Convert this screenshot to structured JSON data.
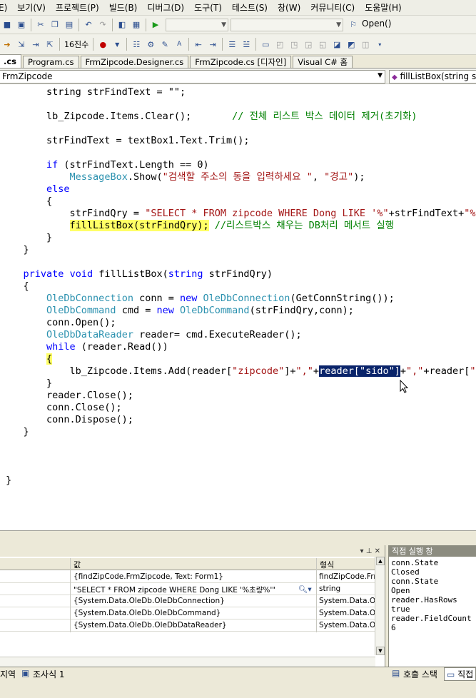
{
  "menu": [
    "E)",
    "보기(V)",
    "프로젝트(P)",
    "빌드(B)",
    "디버그(D)",
    "도구(T)",
    "테스트(S)",
    "창(W)",
    "커뮤니티(C)",
    "도움말(H)"
  ],
  "toolbar": {
    "hex_label": "16진수",
    "find_combo_value": "Open()"
  },
  "tabs": [
    {
      "label": ".cs",
      "active": true
    },
    {
      "label": "Program.cs",
      "active": false
    },
    {
      "label": "FrmZipcode.Designer.cs",
      "active": false
    },
    {
      "label": "FrmZipcode.cs [디자인]",
      "active": false
    },
    {
      "label": "Visual C# 홈",
      "active": false
    }
  ],
  "nav": {
    "type_combo": "FrmZipcode",
    "member_combo": "fillListBox(string s"
  },
  "code_lines": [
    [
      [
        "        string strFindText = \"\";",
        "n"
      ]
    ],
    [
      [
        "",
        "n"
      ]
    ],
    [
      [
        "        lb_Zipcode.Items.Clear();       ",
        "n"
      ],
      [
        "// 전체 리스트 박스 데이터 제거(초기화)",
        "cm"
      ]
    ],
    [
      [
        "",
        "n"
      ]
    ],
    [
      [
        "        strFindText = textBox1.Text.Trim();",
        "n"
      ]
    ],
    [
      [
        "",
        "n"
      ]
    ],
    [
      [
        "        ",
        "n"
      ],
      [
        "if",
        "kw"
      ],
      [
        " (strFindText.Length == 0)",
        "n"
      ]
    ],
    [
      [
        "            ",
        "n"
      ],
      [
        "MessageBox",
        "ty"
      ],
      [
        ".Show(",
        "n"
      ],
      [
        "\"검색할 주소의 동을 입력하세요 \"",
        "str"
      ],
      [
        ", ",
        "n"
      ],
      [
        "\"경고\"",
        "str"
      ],
      [
        ");",
        "n"
      ]
    ],
    [
      [
        "        ",
        "n"
      ],
      [
        "else",
        "kw"
      ]
    ],
    [
      [
        "        {",
        "n"
      ]
    ],
    [
      [
        "            strFindQry = ",
        "n"
      ],
      [
        "\"SELECT * FROM zipcode WHERE Dong LIKE '%\"",
        "str"
      ],
      [
        "+strFindText+",
        "n"
      ],
      [
        "\"%",
        "str"
      ]
    ],
    [
      [
        "            ",
        "n"
      ],
      [
        "fillListBox(strFindQry);",
        "yellow"
      ],
      [
        " ",
        "n"
      ],
      [
        "//리스트박스 채우는 DB처리 메서트 실행",
        "cm"
      ]
    ],
    [
      [
        "        }",
        "n"
      ]
    ],
    [
      [
        "    }",
        "n"
      ]
    ],
    [
      [
        "",
        "n"
      ]
    ],
    [
      [
        "    ",
        "n"
      ],
      [
        "private",
        "kw"
      ],
      [
        " ",
        "n"
      ],
      [
        "void",
        "kw"
      ],
      [
        " fillListBox(",
        "n"
      ],
      [
        "string",
        "kw"
      ],
      [
        " strFindQry)",
        "n"
      ]
    ],
    [
      [
        "    {",
        "n"
      ]
    ],
    [
      [
        "        ",
        "n"
      ],
      [
        "OleDbConnection",
        "ty"
      ],
      [
        " conn = ",
        "n"
      ],
      [
        "new",
        "kw"
      ],
      [
        " ",
        "n"
      ],
      [
        "OleDbConnection",
        "ty"
      ],
      [
        "(GetConnString());",
        "n"
      ]
    ],
    [
      [
        "        ",
        "n"
      ],
      [
        "OleDbCommand",
        "ty"
      ],
      [
        " cmd = ",
        "n"
      ],
      [
        "new",
        "kw"
      ],
      [
        " ",
        "n"
      ],
      [
        "OleDbCommand",
        "ty"
      ],
      [
        "(strFindQry,conn);",
        "n"
      ]
    ],
    [
      [
        "        conn.Open();",
        "n"
      ]
    ],
    [
      [
        "        ",
        "n"
      ],
      [
        "OleDbDataReader",
        "ty"
      ],
      [
        " reader= cmd.ExecuteReader();",
        "n"
      ]
    ],
    [
      [
        "        ",
        "n"
      ],
      [
        "while",
        "kw"
      ],
      [
        " (reader.Read())",
        "n"
      ]
    ],
    [
      [
        "        ",
        "n"
      ],
      [
        "{",
        "yellow"
      ]
    ],
    [
      [
        "            lb_Zipcode.Items.Add(reader[",
        "n"
      ],
      [
        "\"zipcode\"",
        "str"
      ],
      [
        "]+",
        "n"
      ],
      [
        "\",\"",
        "str"
      ],
      [
        "+",
        "n"
      ],
      [
        "reader[\"sido\"]",
        "hl"
      ],
      [
        "+",
        "n"
      ],
      [
        "\",\"",
        "str"
      ],
      [
        "+reader[",
        "n"
      ],
      [
        "\"",
        "str"
      ]
    ],
    [
      [
        "        }",
        "n"
      ]
    ],
    [
      [
        "        reader.Close();",
        "n"
      ]
    ],
    [
      [
        "        conn.Close();",
        "n"
      ]
    ],
    [
      [
        "        conn.Dispose();",
        "n"
      ]
    ],
    [
      [
        "    }",
        "n"
      ]
    ],
    [
      [
        "",
        "n"
      ]
    ],
    [
      [
        "",
        "n"
      ]
    ],
    [
      [
        "",
        "n"
      ]
    ],
    [
      [
        " }",
        "n"
      ]
    ]
  ],
  "watch": {
    "header_value": "값",
    "header_type": "형식",
    "rows": [
      {
        "value": "{findZipCode.FrmZipcode, Text: Form1}",
        "type": "findZipCode.Frm"
      },
      {
        "value": "\"SELECT * FROM zipcode WHERE Dong LIKE '%초량%'\"",
        "type": "string"
      },
      {
        "value": "{System.Data.OleDb.OleDbConnection}",
        "type": "System.Data.O"
      },
      {
        "value": "{System.Data.OleDb.OleDbCommand}",
        "type": "System.Data.O"
      },
      {
        "value": "{System.Data.OleDb.OleDbDataReader}",
        "type": "System.Data.O"
      }
    ]
  },
  "immediate": {
    "title": "직접 실행 창",
    "lines": [
      "conn.State",
      "Closed",
      "conn.State",
      "Open",
      "reader.HasRows",
      "true",
      "reader.FieldCount",
      "6"
    ]
  },
  "bottom_tabs": {
    "locals": "지역",
    "watch1": "조사식 1",
    "callstack": "호출 스택",
    "immediate_tab": "직접"
  }
}
